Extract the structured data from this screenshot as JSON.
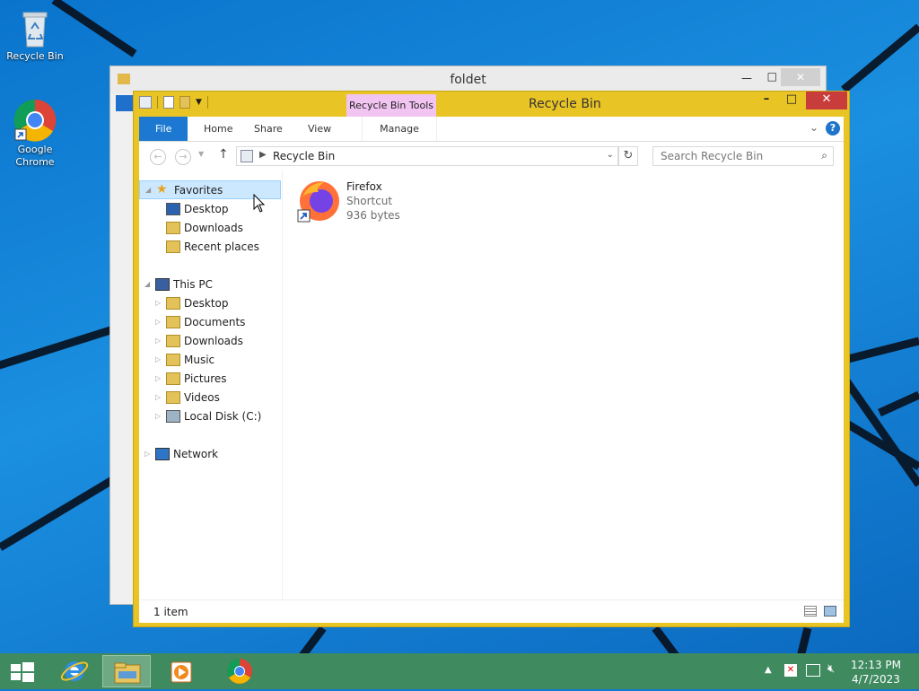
{
  "desktop": {
    "icons": [
      {
        "label": "Recycle Bin",
        "icon": "recycle-bin-icon"
      },
      {
        "label": "Google Chrome",
        "icon": "chrome-icon"
      }
    ]
  },
  "back_window": {
    "title": "foldet"
  },
  "window": {
    "title": "Recycle Bin",
    "context_tab": "Recycle Bin Tools",
    "ribbon_tabs": [
      "File",
      "Home",
      "Share",
      "View",
      "Manage"
    ],
    "address_path": "Recycle Bin",
    "search_placeholder": "Search Recycle Bin",
    "nav": {
      "favorites": "Favorites",
      "fav_items": [
        "Desktop",
        "Downloads",
        "Recent places"
      ],
      "this_pc": "This PC",
      "pc_items": [
        "Desktop",
        "Documents",
        "Downloads",
        "Music",
        "Pictures",
        "Videos",
        "Local Disk (C:)"
      ],
      "network": "Network"
    },
    "files": [
      {
        "name": "Firefox",
        "type": "Shortcut",
        "size": "936 bytes"
      }
    ],
    "status": "1 item"
  },
  "taskbar": {
    "time": "12:13 PM",
    "date": "4/7/2023",
    "accent": "#3f8a5f"
  }
}
